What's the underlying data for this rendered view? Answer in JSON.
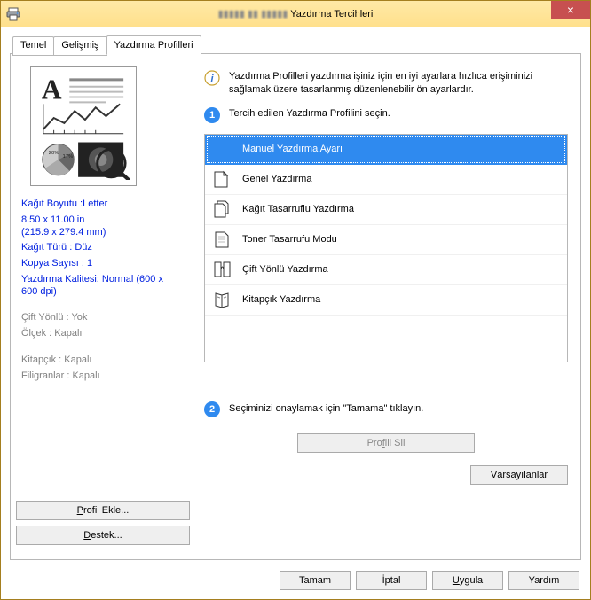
{
  "window": {
    "title_blur": "▮▮▮▮▮ ▮▮ ▮▮▮▮▮",
    "title": "Yazdırma Tercihleri",
    "icon": "printer-icon",
    "close": "×"
  },
  "tabs": [
    {
      "label": "Temel",
      "active": false
    },
    {
      "label": "Gelişmiş",
      "active": false
    },
    {
      "label": "Yazdırma Profilleri",
      "active": true
    }
  ],
  "sidebar": {
    "items": [
      {
        "text": "Kağıt Boyutu :Letter",
        "cls": "blue"
      },
      {
        "text": "8.50 x 11.00 in\n(215.9 x 279.4 mm)",
        "cls": "blue"
      },
      {
        "text": "Kağıt Türü : Düz",
        "cls": "blue"
      },
      {
        "text": "Kopya Sayısı : 1",
        "cls": "blue"
      },
      {
        "text": "Yazdırma Kalitesi: Normal (600 x 600 dpi)",
        "cls": "blue gap"
      },
      {
        "text": "Çift Yönlü : Yok",
        "cls": "grey"
      },
      {
        "text": "Ölçek : Kapalı",
        "cls": "grey gap"
      },
      {
        "text": "Kitapçık : Kapalı",
        "cls": "grey"
      },
      {
        "text": "Filigranlar : Kapalı",
        "cls": "grey"
      }
    ]
  },
  "hints": {
    "info": "Yazdırma Profilleri yazdırma işiniz için en iyi ayarlara hızlıca erişiminizi sağlamak üzere tasarlanmış düzenlenebilir ön ayarlardır.",
    "step1": "Tercih edilen Yazdırma Profilini seçin.",
    "step2": "Seçiminizi onaylamak için \"Tamama\" tıklayın."
  },
  "profiles": [
    {
      "label": "Manuel Yazdırma Ayarı",
      "icon": "none",
      "selected": true
    },
    {
      "label": "Genel Yazdırma",
      "icon": "page-icon",
      "selected": false
    },
    {
      "label": "Kağıt Tasarruflu Yazdırma",
      "icon": "pages-icon",
      "selected": false
    },
    {
      "label": "Toner Tasarrufu Modu",
      "icon": "toner-icon",
      "selected": false
    },
    {
      "label": "Çift Yönlü Yazdırma",
      "icon": "duplex-icon",
      "selected": false
    },
    {
      "label": "Kitapçık Yazdırma",
      "icon": "booklet-icon",
      "selected": false
    }
  ],
  "buttons": {
    "delete_profile": "Profili Sil",
    "defaults": "Varsayılanlar",
    "add_profile": "Profil Ekle...",
    "support": "Destek...",
    "ok": "Tamam",
    "cancel": "İptal",
    "apply": "Uygula",
    "help": "Yardım"
  }
}
